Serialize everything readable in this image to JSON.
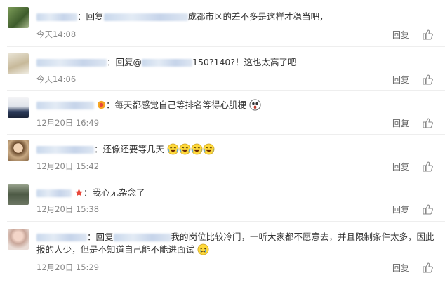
{
  "comments": [
    {
      "id": "c1",
      "top": 0,
      "text_prefix": "：回复",
      "text": "成都市区的差不多是这样才稳当吧，",
      "time": "今天14:08",
      "reply_label": "回复"
    },
    {
      "id": "c2",
      "text_prefix": "：回复@",
      "text": "150?140?！这也太高了吧",
      "time": "今天14:06",
      "reply_label": "回复"
    },
    {
      "id": "c3",
      "text_prefix": "：",
      "text": "每天都感觉自己等排名等得心肌梗",
      "time": "12月20日 16:49",
      "reply_label": "回复"
    },
    {
      "id": "c4",
      "text_prefix": "：",
      "text": "还像还要等几天",
      "time": "12月20日 15:42",
      "reply_label": "回复"
    },
    {
      "id": "c5",
      "text_prefix": "：",
      "text": "我心无杂念了",
      "time": "12月20日 15:38",
      "reply_label": "回复"
    },
    {
      "id": "c6",
      "text_prefix": "：回复",
      "text": "我的岗位比较冷门，一听大家都不愿意去，并且限制条件太多，因此",
      "text_line2": "报的人少，但是不知道自己能不能进面试",
      "time": "12月20日 15:29",
      "reply_label": "回复"
    }
  ],
  "colors": {
    "mention": "#eb7350",
    "time": "#888888",
    "separator": "#eeeeee"
  }
}
